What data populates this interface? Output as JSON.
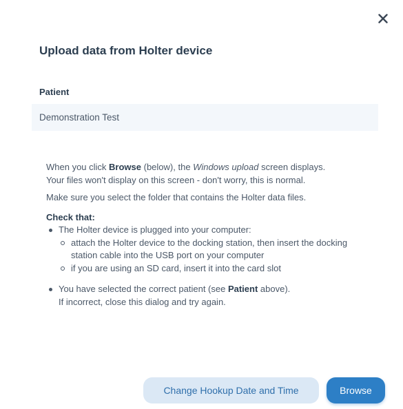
{
  "dialog": {
    "title": "Upload data from Holter device",
    "close_icon": "close-icon"
  },
  "patient": {
    "label": "Patient",
    "value": "Demonstration Test"
  },
  "instructions": {
    "line1_pre": "When you click ",
    "line1_browse": "Browse",
    "line1_mid": " (below), the ",
    "line1_windows": "Windows upload",
    "line1_post": " screen displays.",
    "line2": "Your files won't display on this screen - don't worry, this is normal.",
    "line3": "Make sure you select the folder that contains the Holter data files.",
    "check_title": "Check that:",
    "bullet1": "The Holter device is plugged into your computer:",
    "sub1": "attach the Holter device to the docking station, then insert the docking station cable into the USB port on your computer",
    "sub2": "if you are using an SD card, insert it into the card slot",
    "bullet2_pre": "You have selected the correct patient (see ",
    "bullet2_bold": "Patient",
    "bullet2_post": " above).",
    "bullet2_line2": "If incorrect, close this dialog and try again."
  },
  "buttons": {
    "change_hookup": "Change Hookup Date and Time",
    "browse": "Browse"
  },
  "colors": {
    "primary": "#2d7fc6",
    "secondary_bg": "#dbe8f5",
    "field_bg": "#f3f7fb"
  }
}
